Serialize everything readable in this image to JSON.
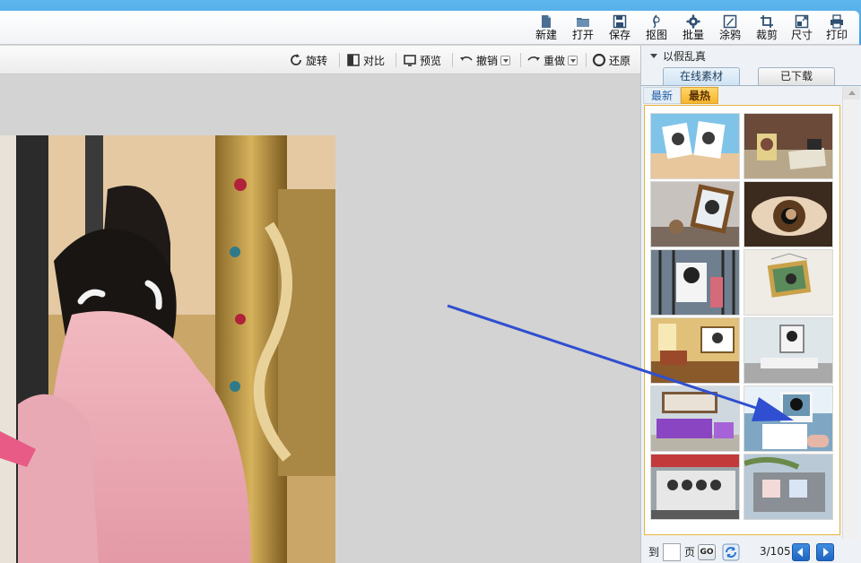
{
  "main_toolbar": [
    {
      "id": "new",
      "label": "新建",
      "icon": "new-file-icon"
    },
    {
      "id": "open",
      "label": "打开",
      "icon": "folder-icon"
    },
    {
      "id": "save",
      "label": "保存",
      "icon": "save-icon"
    },
    {
      "id": "cutout",
      "label": "抠图",
      "icon": "cutout-icon"
    },
    {
      "id": "batch",
      "label": "批量",
      "icon": "gear-icon"
    },
    {
      "id": "doodle",
      "label": "涂鸦",
      "icon": "brush-icon"
    },
    {
      "id": "crop",
      "label": "裁剪",
      "icon": "crop-icon"
    },
    {
      "id": "size",
      "label": "尺寸",
      "icon": "resize-icon"
    },
    {
      "id": "print",
      "label": "打印",
      "icon": "printer-icon"
    }
  ],
  "edit_toolbar": {
    "rotate": "旋转",
    "compare": "对比",
    "preview": "预览",
    "undo": "撤销",
    "redo": "重做",
    "restore": "还原"
  },
  "panel": {
    "title": "以假乱真",
    "tabs": {
      "online": "在线素材",
      "downloaded": "已下载"
    },
    "subtabs": {
      "new": "最新",
      "hot": "最热"
    },
    "active_subtab": "hot",
    "thumbnails": [
      "photo-book-template",
      "camera-desk-template",
      "photo-frame-template",
      "eye-template",
      "street-template",
      "hanging-frame-template",
      "living-room-template",
      "bedroom-template",
      "sofa-room-template",
      "hand-photo-template",
      "shop-front-template",
      "street-scene-template"
    ],
    "pager": {
      "goto": "到",
      "page": "页",
      "go": "GO",
      "count": "3/105"
    }
  },
  "colors": {
    "title_bar": "#4aa7e8",
    "hot_tab": "#f5b52a",
    "arrow": "#2f4fd0",
    "nav": "#2a74d0"
  }
}
